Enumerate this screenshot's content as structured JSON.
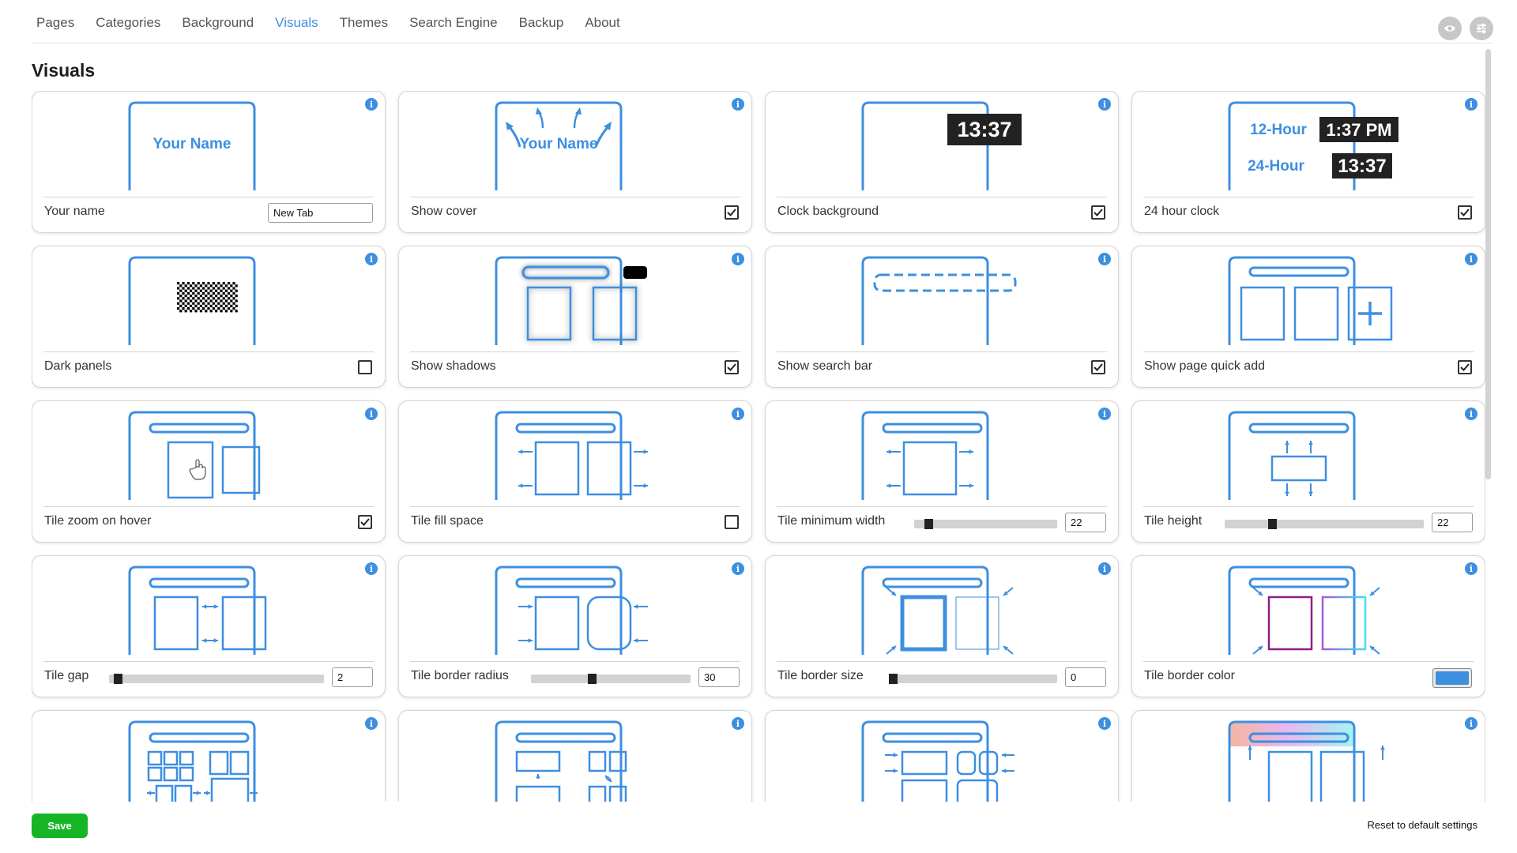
{
  "nav": {
    "tabs": [
      "Pages",
      "Categories",
      "Background",
      "Visuals",
      "Themes",
      "Search Engine",
      "Backup",
      "About"
    ],
    "active_tab": "Visuals",
    "icons": [
      "eye-icon",
      "sliders-icon"
    ]
  },
  "page_title": "Visuals",
  "colors": {
    "accent": "#3d8fe0",
    "save": "#16b526",
    "tile_border_color": "#3d8fe0"
  },
  "illustration_text": {
    "your_name": "Your Name",
    "clock": "13:37",
    "twelve_hour_label": "12-Hour",
    "twelve_hour_time": "1:37 PM",
    "twenty_four_hour_label": "24-Hour",
    "twenty_four_hour_time": "13:37"
  },
  "settings": [
    {
      "id": "your-name",
      "label": "Your name",
      "control": "text",
      "value": "New Tab"
    },
    {
      "id": "show-cover",
      "label": "Show cover",
      "control": "checkbox",
      "checked": true
    },
    {
      "id": "clock-background",
      "label": "Clock background",
      "control": "checkbox",
      "checked": true
    },
    {
      "id": "24-hour-clock",
      "label": "24 hour clock",
      "control": "checkbox",
      "checked": true
    },
    {
      "id": "dark-panels",
      "label": "Dark panels",
      "control": "checkbox",
      "checked": false
    },
    {
      "id": "show-shadows",
      "label": "Show shadows",
      "control": "checkbox",
      "checked": true
    },
    {
      "id": "show-search-bar",
      "label": "Show search bar",
      "control": "checkbox",
      "checked": true
    },
    {
      "id": "show-page-quick-add",
      "label": "Show page quick add",
      "control": "checkbox",
      "checked": true
    },
    {
      "id": "tile-zoom-on-hover",
      "label": "Tile zoom on hover",
      "control": "checkbox",
      "checked": true
    },
    {
      "id": "tile-fill-space",
      "label": "Tile fill space",
      "control": "checkbox",
      "checked": false
    },
    {
      "id": "tile-minimum-width",
      "label": "Tile minimum width",
      "control": "slider",
      "value": "22",
      "level": 0.1
    },
    {
      "id": "tile-height",
      "label": "Tile height",
      "control": "slider",
      "value": "22",
      "level": 0.24
    },
    {
      "id": "tile-gap",
      "label": "Tile gap",
      "control": "slider",
      "value": "2",
      "level": 0.04
    },
    {
      "id": "tile-border-radius",
      "label": "Tile border radius",
      "control": "slider",
      "value": "30",
      "level": 0.38
    },
    {
      "id": "tile-border-size",
      "label": "Tile border size",
      "control": "slider",
      "value": "0",
      "level": 0.02
    },
    {
      "id": "tile-border-color",
      "label": "Tile border color",
      "control": "color",
      "value": "#3d8fe0"
    },
    {
      "id": "tile-layout-grid",
      "label": "",
      "control": "none"
    },
    {
      "id": "tile-layout-mixed",
      "label": "",
      "control": "none"
    },
    {
      "id": "tile-layout-align",
      "label": "",
      "control": "none"
    },
    {
      "id": "header-gradient",
      "label": "",
      "control": "none"
    }
  ],
  "footer": {
    "save_label": "Save",
    "reset_label": "Reset to default settings"
  }
}
